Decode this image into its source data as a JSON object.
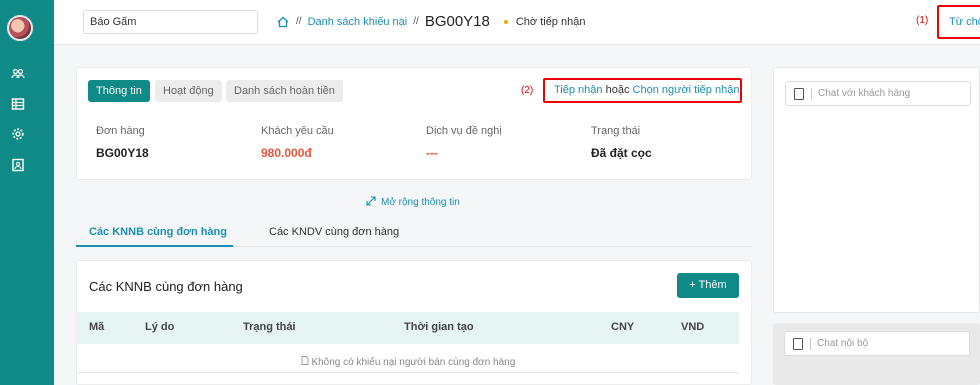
{
  "sidebar": {
    "icons": [
      "user-group-icon",
      "list-icon",
      "settings-icon",
      "report-icon"
    ]
  },
  "topbar": {
    "store_value": "Báo Gấm",
    "breadcrumb": {
      "separator": "//",
      "list_link": "Danh sách khiếu nại",
      "code": "BG00Y18",
      "status": "Chờ tiếp nhận"
    },
    "annotation_1": "(1)",
    "reject_label": "Từ chối"
  },
  "info_card": {
    "tabs": [
      "Thông tin",
      "Hoạt động",
      "Danh sách hoàn tiền"
    ],
    "annotation_2": "(2)",
    "accept_link": "Tiếp nhận",
    "accept_or": "hoặc",
    "choose_link": "Chọn người tiếp nhận",
    "fields": [
      {
        "label": "Đơn hàng",
        "value": "BG00Y18"
      },
      {
        "label": "Khách yêu cầu",
        "value": "980.000đ"
      },
      {
        "label": "Dịch vụ đề nghị",
        "value": "---"
      },
      {
        "label": "Trạng thái",
        "value": "Đã đặt cọc"
      }
    ],
    "value_accent_color": "#f0533b"
  },
  "expand_label": "Mở rộng thông tin",
  "subtabs": [
    "Các KNNB cùng đơn hàng",
    "Các KNDV cùng đơn hàng"
  ],
  "list_card": {
    "title": "Các KNNB cùng đơn hàng",
    "add_label": "+ Thêm",
    "columns": [
      "Mã",
      "Lý do",
      "Trạng thái",
      "Thời gian tạo",
      "CNY",
      "VND"
    ],
    "empty_text": "Không có khiếu nại người bán cùng đơn hàng"
  },
  "chat": {
    "customer_placeholder": "Chat với khách hàng",
    "internal_placeholder": "Chat nội bộ"
  },
  "colors": {
    "primary": "#0f8a87",
    "link": "#1a8fb0",
    "status_dot": "#f2a600",
    "highlight_border": "#e00000"
  }
}
